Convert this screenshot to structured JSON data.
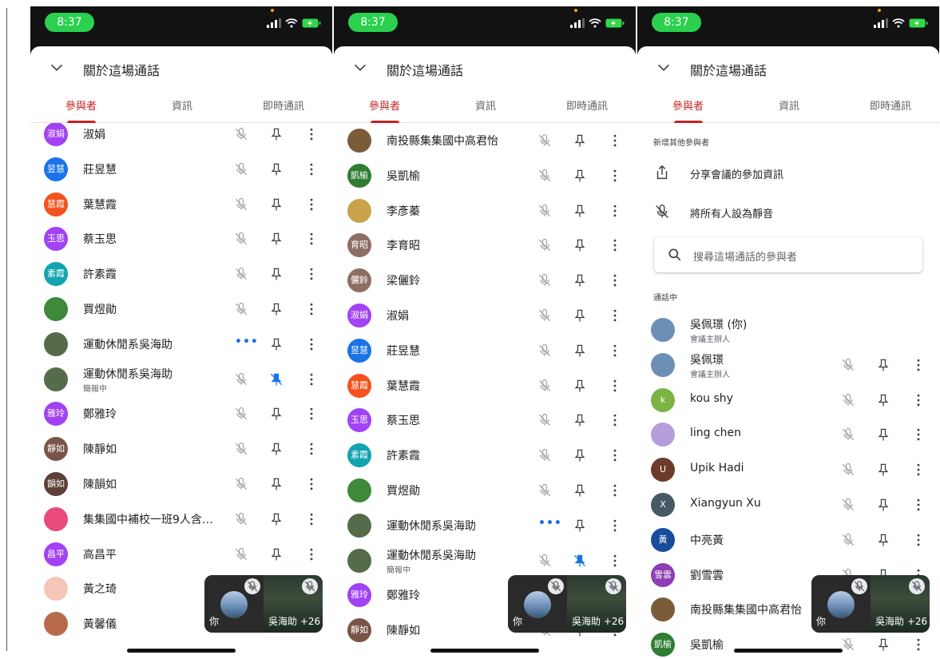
{
  "status": {
    "time": "8:37"
  },
  "header": {
    "title": "關於這場通話"
  },
  "tabs": [
    {
      "label": "參與者"
    },
    {
      "label": "資訊"
    },
    {
      "label": "即時通訊"
    }
  ],
  "screen1": {
    "participants": [
      {
        "name": "淑娟",
        "initials": "淑娟",
        "color": "#a142f4"
      },
      {
        "name": "莊昱慧",
        "initials": "昱慧",
        "color": "#1a73e8"
      },
      {
        "name": "葉慧霞",
        "initials": "慧霞",
        "color": "#f4511e"
      },
      {
        "name": "蔡玉思",
        "initials": "玉思",
        "color": "#a142f4"
      },
      {
        "name": "許素霞",
        "initials": "素霞",
        "color": "#12a4af"
      },
      {
        "name": "買煜勛",
        "initials": "",
        "color": "#3c8a3a"
      },
      {
        "name": "運動休閒系吳海助",
        "initials": "",
        "color": "#556b4a",
        "speaking": true
      },
      {
        "name": "運動休閒系吳海助",
        "initials": "",
        "color": "#556b4a",
        "subtitle": "簡報中",
        "pinned": true
      },
      {
        "name": "鄭雅玲",
        "initials": "雅玲",
        "color": "#a142f4"
      },
      {
        "name": "陳靜如",
        "initials": "靜如",
        "color": "#795548"
      },
      {
        "name": "陳韻如",
        "initials": "韻如",
        "color": "#5d4037"
      },
      {
        "name": "集集國中補校一班9人含…",
        "initials": "",
        "color": "#e84a7a"
      },
      {
        "name": "高昌平",
        "initials": "昌平",
        "color": "#a142f4"
      },
      {
        "name": "黃之琦",
        "initials": "",
        "color": "#f3c6b8"
      },
      {
        "name": "黃馨儀",
        "initials": "",
        "color": "#b86b4b"
      }
    ]
  },
  "screen2": {
    "participants": [
      {
        "name": "南投縣集集國中高君怡",
        "initials": "",
        "color": "#7a5c3a"
      },
      {
        "name": "吳凱榆",
        "initials": "凱榆",
        "color": "#2e7d32"
      },
      {
        "name": "李彥蓁",
        "initials": "",
        "color": "#c9a24a"
      },
      {
        "name": "李育昭",
        "initials": "育昭",
        "color": "#8d6e63"
      },
      {
        "name": "梁儷鈴",
        "initials": "儷鈴",
        "color": "#8d6e63"
      },
      {
        "name": "淑娟",
        "initials": "淑娟",
        "color": "#a142f4"
      },
      {
        "name": "莊昱慧",
        "initials": "昱慧",
        "color": "#1a73e8"
      },
      {
        "name": "葉慧霞",
        "initials": "慧霞",
        "color": "#f4511e"
      },
      {
        "name": "蔡玉思",
        "initials": "玉思",
        "color": "#a142f4"
      },
      {
        "name": "許素霞",
        "initials": "素霞",
        "color": "#12a4af"
      },
      {
        "name": "買煜勛",
        "initials": "",
        "color": "#3c8a3a"
      },
      {
        "name": "運動休閒系吳海助",
        "initials": "",
        "color": "#556b4a",
        "speaking": true
      },
      {
        "name": "運動休閒系吳海助",
        "initials": "",
        "color": "#556b4a",
        "subtitle": "簡報中",
        "pinned": true
      },
      {
        "name": "鄭雅玲",
        "initials": "雅玲",
        "color": "#a142f4"
      },
      {
        "name": "陳靜如",
        "initials": "靜如",
        "color": "#795548"
      }
    ]
  },
  "screen3": {
    "add_label": "新增其他參與者",
    "share_label": "分享會議的參加資訊",
    "mute_all_label": "將所有人設為靜音",
    "search_placeholder": "搜尋這場通話的參與者",
    "in_call_label": "通話中",
    "participants": [
      {
        "name": "吳佩璟 (你)",
        "subtitle": "會議主辦人",
        "initials": "",
        "color": "#6d8fb6",
        "self": true
      },
      {
        "name": "吳佩璟",
        "subtitle": "會議主辦人",
        "initials": "",
        "color": "#6d8fb6"
      },
      {
        "name": "kou shy",
        "initials": "k",
        "color": "#7cb342"
      },
      {
        "name": "ling chen",
        "initials": "",
        "color": "#b39ddb"
      },
      {
        "name": "Upik Hadi",
        "initials": "U",
        "color": "#6d3b2a"
      },
      {
        "name": "Xiangyun Xu",
        "initials": "X",
        "color": "#455a64"
      },
      {
        "name": "中亮黃",
        "initials": "黃",
        "color": "#1a4c9c"
      },
      {
        "name": "劉雪雲",
        "initials": "雪雲",
        "color": "#8e3fb5"
      },
      {
        "name": "南投縣集集國中高君怡",
        "initials": "",
        "color": "#7a5c3a"
      },
      {
        "name": "吳凱榆",
        "initials": "凱榆",
        "color": "#2e7d32"
      }
    ]
  },
  "tile": {
    "you_label": "你",
    "other_label": "吳海助 +26"
  }
}
